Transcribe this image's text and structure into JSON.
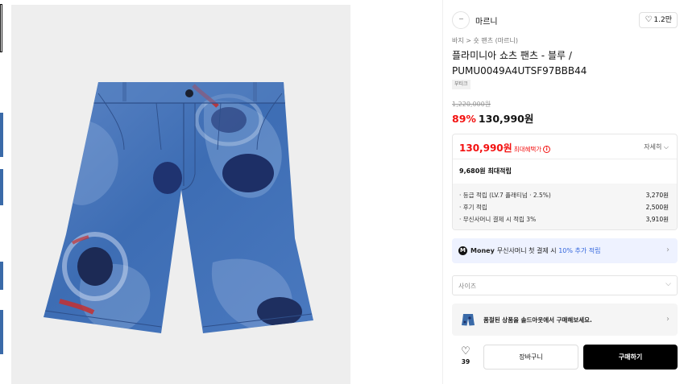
{
  "brand": {
    "logo_text": "·····",
    "name": "마르니",
    "like_count": "1.2만",
    "like_icon": "heart-outline-icon"
  },
  "breadcrumb": "바지 > 숏 팬츠 (마르니)",
  "product": {
    "title": "플라미니아 쇼츠 팬츠 - 블루 / PUMU0049A4UTSF97BBB44",
    "tag": "부티크",
    "original_price": "1,220,000원",
    "discount": "89%",
    "price": "130,990원"
  },
  "benefit": {
    "price": "130,990원",
    "max_label": "최대혜택가",
    "info_icon": "info-circle-icon",
    "detail_label": "자세히",
    "points_title": "9,680원 최대적립",
    "rows": [
      {
        "label": "· 등급 적립 (LV.7 플래티넘 · 2.5%)",
        "value": "3,270원"
      },
      {
        "label": "· 후기 적립",
        "value": "2,500원"
      },
      {
        "label": "· 무신사머니 결제 시 적립 3%",
        "value": "3,910원"
      }
    ]
  },
  "money_banner": {
    "badge": "M",
    "brand": "Money",
    "text": "무신사머니 첫 결제 시 ",
    "highlight": "10% 추가 적립",
    "chevron": "›"
  },
  "size_select": {
    "placeholder": "사이즈",
    "arrow": "⌵"
  },
  "soldout": {
    "text": "품절된 상품을 솔드아웃에서 구매해보세요.",
    "chevron": "›"
  },
  "actions": {
    "wish_icon": "♡",
    "wish_count": "39",
    "cart_label": "장바구니",
    "buy_label": "구매하기"
  },
  "colors": {
    "accent_red": "#f31110",
    "money_blue": "#3366dd",
    "shorts_blue": "#3a6aa8"
  }
}
